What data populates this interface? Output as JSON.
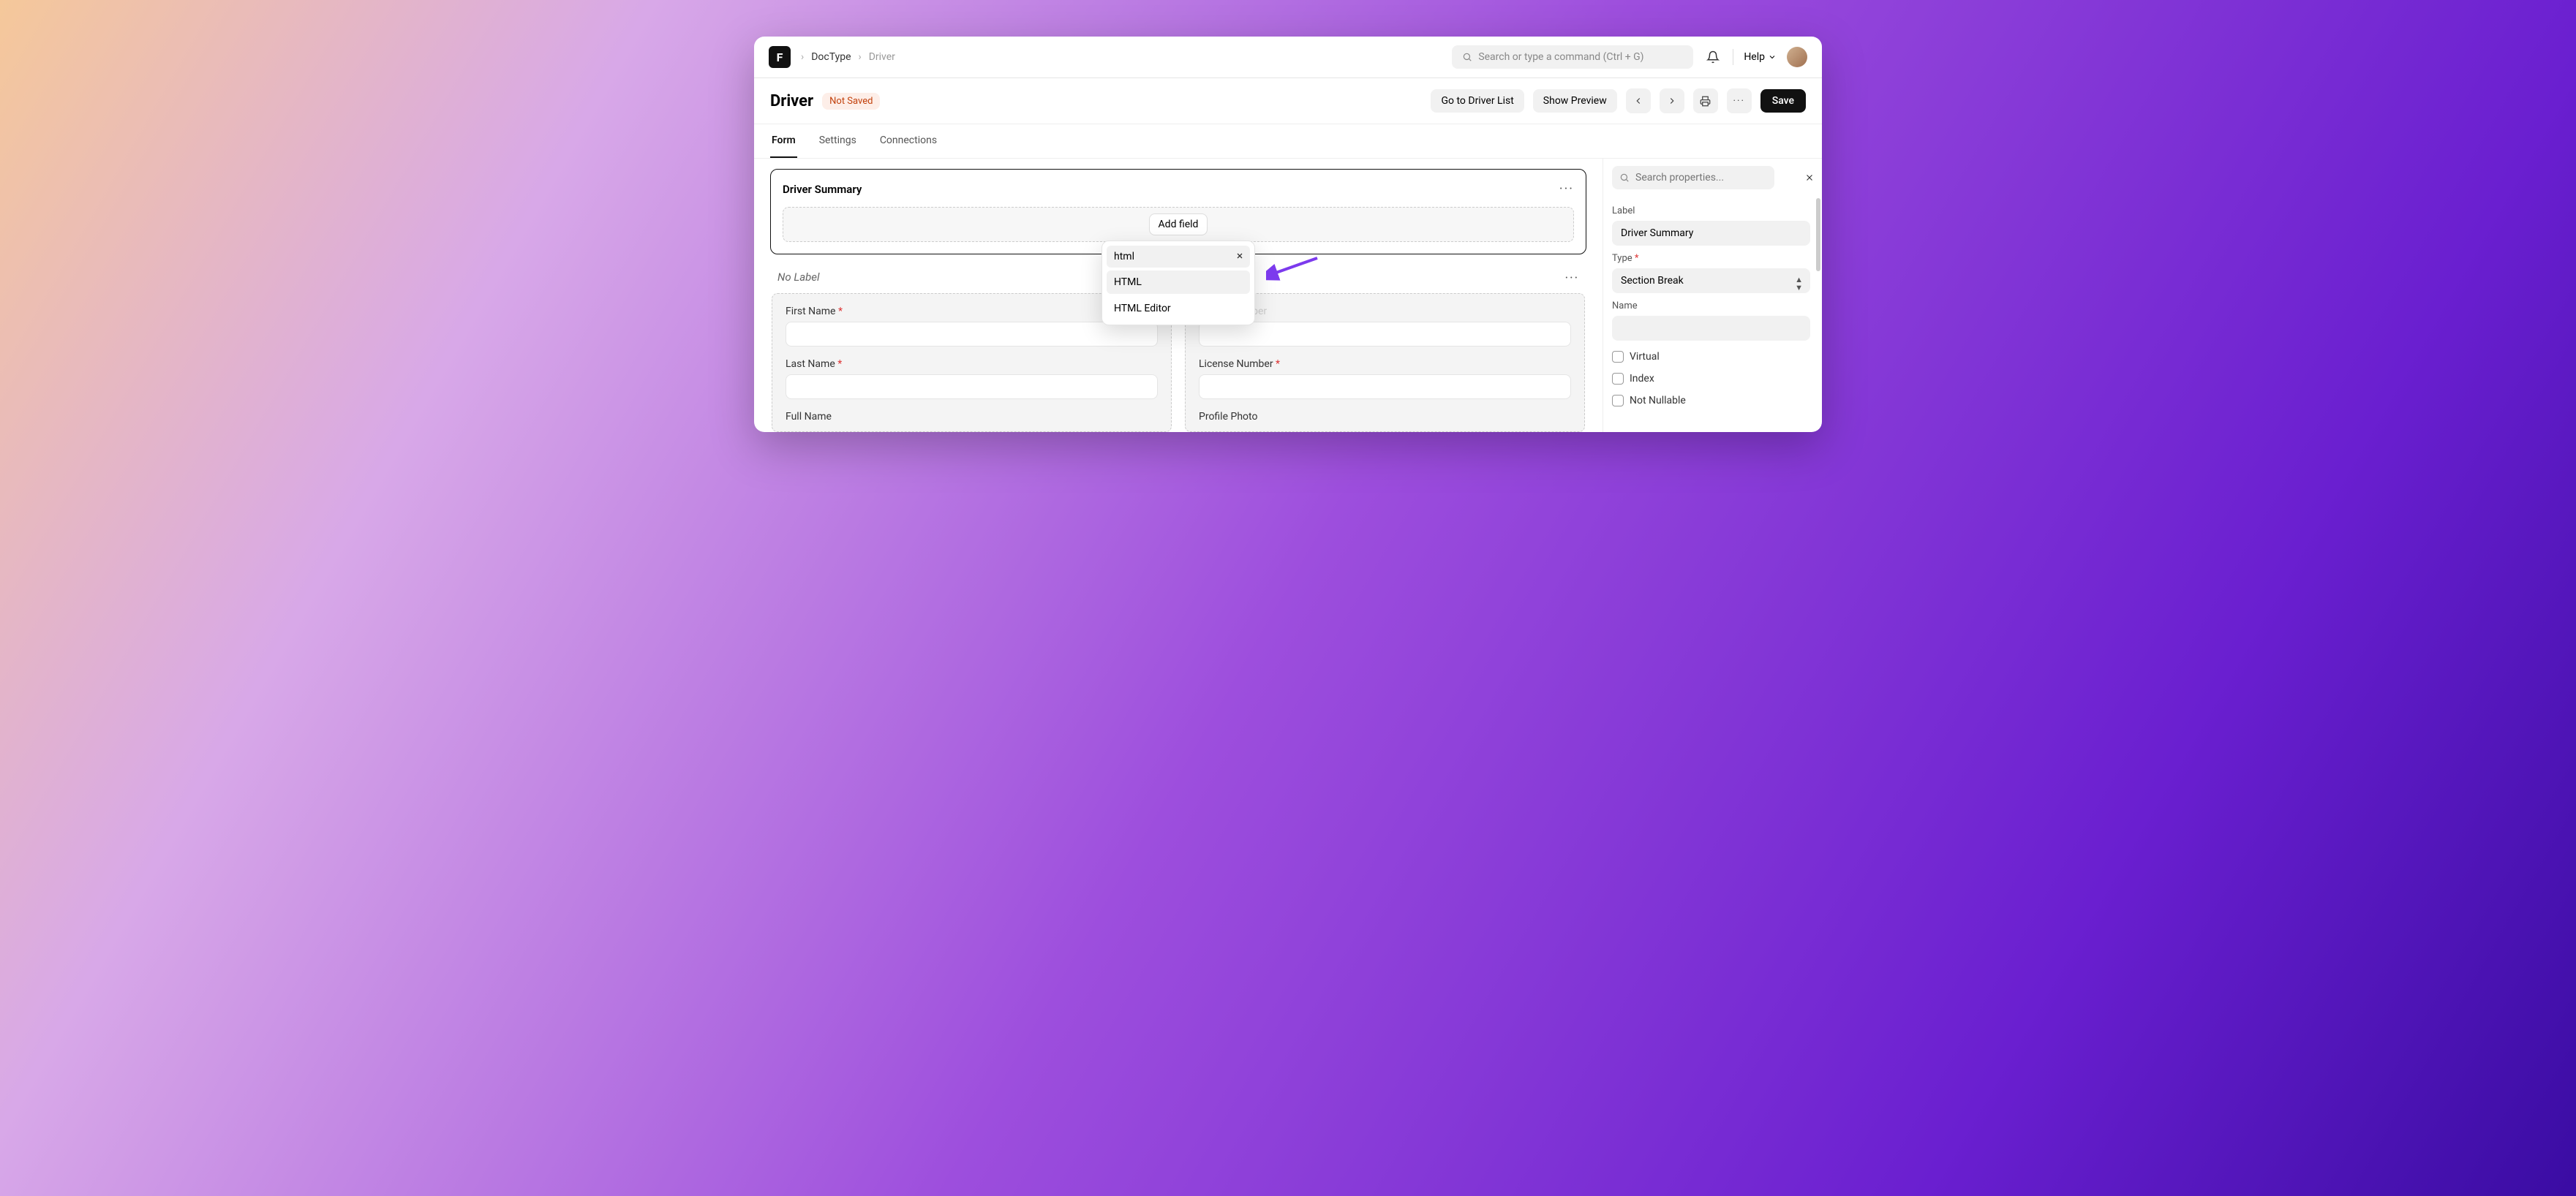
{
  "breadcrumb": {
    "item1": "DocType",
    "item2": "Driver"
  },
  "search_placeholder": "Search or type a command (Ctrl + G)",
  "help_label": "Help",
  "page": {
    "title": "Driver",
    "status_badge": "Not Saved"
  },
  "actions": {
    "go_list": "Go to Driver List",
    "show_preview": "Show Preview",
    "save": "Save"
  },
  "tabs": {
    "form": "Form",
    "settings": "Settings",
    "connections": "Connections"
  },
  "section_summary": {
    "title": "Driver Summary",
    "add_field": "Add field"
  },
  "popup": {
    "query": "html",
    "options": [
      "HTML",
      "HTML Editor"
    ]
  },
  "section_nolabel": {
    "heading": "No Label",
    "left": [
      {
        "label": "First Name",
        "required": true,
        "has_input": true
      },
      {
        "label": "Last Name",
        "required": true,
        "has_input": true
      },
      {
        "label": "Full Name",
        "required": false,
        "has_input": false
      }
    ],
    "right": [
      {
        "label": "Phone Number",
        "required": false,
        "has_input": true,
        "faded": true
      },
      {
        "label": "License Number",
        "required": true,
        "has_input": true
      },
      {
        "label": "Profile Photo",
        "required": false,
        "has_input": false
      }
    ]
  },
  "sidebar": {
    "search_placeholder": "Search properties...",
    "label_label": "Label",
    "label_value": "Driver Summary",
    "type_label": "Type",
    "type_required": "*",
    "type_value": "Section Break",
    "name_label": "Name",
    "name_value": "",
    "checks": {
      "virtual": "Virtual",
      "index": "Index",
      "not_nullable": "Not Nullable"
    }
  }
}
